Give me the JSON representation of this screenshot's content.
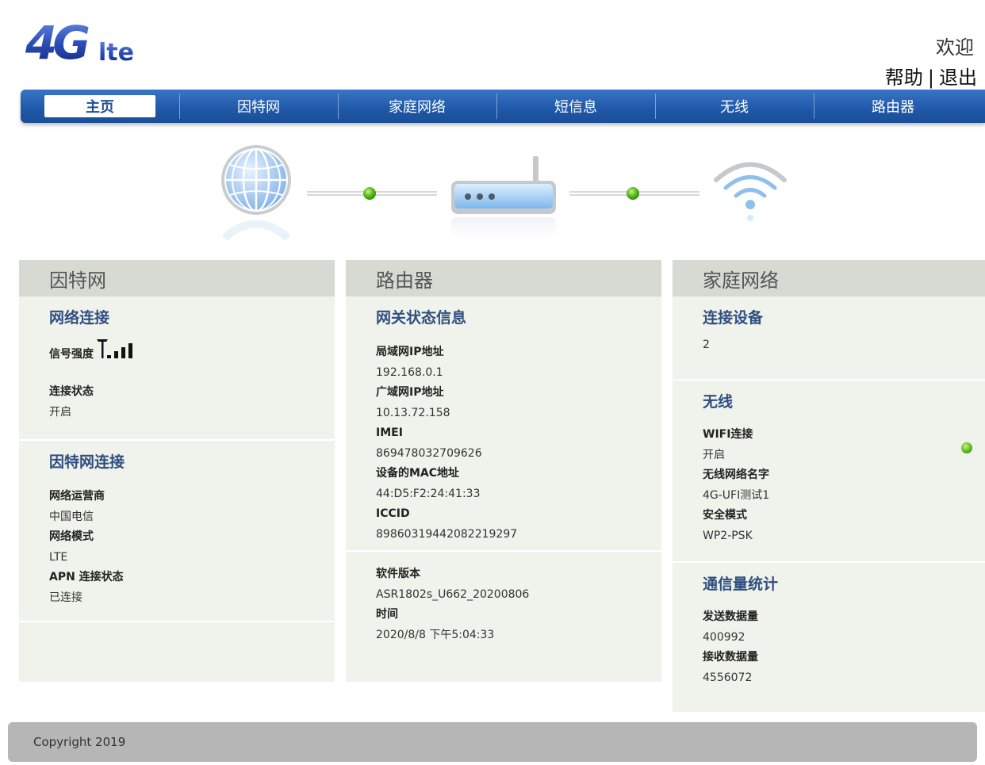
{
  "header": {
    "logo_text": "4Glte",
    "welcome": "欢迎",
    "help": "帮助",
    "separator": "|",
    "logout": "退出"
  },
  "nav": {
    "items": [
      "主页",
      "因特网",
      "家庭网络",
      "短信息",
      "无线",
      "路由器"
    ],
    "active_index": 0
  },
  "topology": {
    "icons": [
      "globe-icon",
      "router-icon",
      "wifi-icon"
    ],
    "link_status_color": "#4db216"
  },
  "internet_panel": {
    "title": "因特网",
    "network": {
      "title": "网络连接",
      "signal_label": "信号强度",
      "signal_bars": 4,
      "signal_bars_max": 4,
      "status_label": "连接状态",
      "status_value": "开启"
    },
    "connection": {
      "title": "因特网连接",
      "operator_label": "网络运营商",
      "operator_value": "中国电信",
      "mode_label": "网络模式",
      "mode_value": "LTE",
      "apn_label": "APN 连接状态",
      "apn_value": "已连接"
    }
  },
  "router_panel": {
    "title": "路由器",
    "gateway": {
      "title": "网关状态信息",
      "lan_ip_label": "局域网IP地址",
      "lan_ip_value": "192.168.0.1",
      "wan_ip_label": "广域网IP地址",
      "wan_ip_value": "10.13.72.158",
      "imei_label": "IMEI",
      "imei_value": "869478032709626",
      "mac_label": "设备的MAC地址",
      "mac_value": "44:D5:F2:24:41:33",
      "iccid_label": "ICCID",
      "iccid_value": "89860319442082219297"
    },
    "software": {
      "version_label": "软件版本",
      "version_value": "ASR1802s_U662_20200806",
      "time_label": "时间",
      "time_value": "2020/8/8 下午5:04:33"
    }
  },
  "home_panel": {
    "title": "家庭网络",
    "devices": {
      "title": "连接设备",
      "count": "2"
    },
    "wireless": {
      "title": "无线",
      "wifi_label": "WIFI连接",
      "wifi_value": "开启",
      "ssid_label": "无线网络名字",
      "ssid_value": "4G-UFI测试1",
      "security_label": "安全模式",
      "security_value": "WP2-PSK"
    },
    "traffic": {
      "title": "通信量统计",
      "sent_label": "发送数据量",
      "sent_value": "400992",
      "recv_label": "接收数据量",
      "recv_value": "4556072"
    }
  },
  "footer": {
    "copyright": "Copyright 2019"
  }
}
